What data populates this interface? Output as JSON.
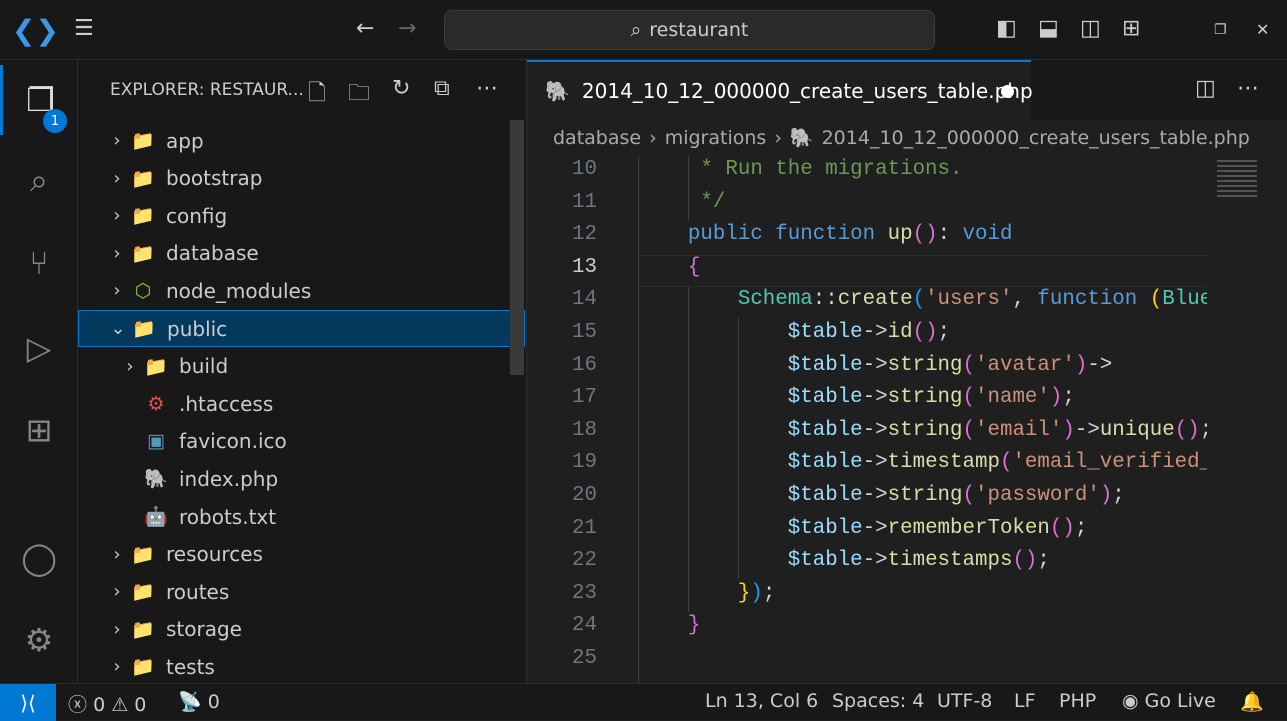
{
  "titlebar": {
    "search_text": "restaurant"
  },
  "activity": {
    "explorer_badge": "1"
  },
  "sidebar": {
    "title": "EXPLORER: RESTAUR...",
    "items": [
      {
        "label": "app",
        "type": "folder",
        "depth": 0,
        "open": false
      },
      {
        "label": "bootstrap",
        "type": "folder",
        "depth": 0,
        "open": false
      },
      {
        "label": "config",
        "type": "folder",
        "depth": 0,
        "open": false
      },
      {
        "label": "database",
        "type": "folder",
        "depth": 0,
        "open": false
      },
      {
        "label": "node_modules",
        "type": "node",
        "depth": 0,
        "open": false
      },
      {
        "label": "public",
        "type": "folder",
        "depth": 0,
        "open": true,
        "selected": true
      },
      {
        "label": "build",
        "type": "folder",
        "depth": 1,
        "open": false
      },
      {
        "label": ".htaccess",
        "type": "gear",
        "depth": 1
      },
      {
        "label": "favicon.ico",
        "type": "image",
        "depth": 1
      },
      {
        "label": "index.php",
        "type": "php",
        "depth": 1
      },
      {
        "label": "robots.txt",
        "type": "robot",
        "depth": 1
      },
      {
        "label": "resources",
        "type": "folder",
        "depth": 0,
        "open": false
      },
      {
        "label": "routes",
        "type": "folder",
        "depth": 0,
        "open": false
      },
      {
        "label": "storage",
        "type": "folder",
        "depth": 0,
        "open": false
      },
      {
        "label": "tests",
        "type": "folder",
        "depth": 0,
        "open": false
      }
    ]
  },
  "editor": {
    "tab_label": "2014_10_12_000000_create_users_table.php",
    "breadcrumbs": [
      "database",
      "migrations",
      "2014_10_12_000000_create_users_table.php"
    ],
    "current_line": 13,
    "lines": [
      {
        "n": 10,
        "tokens": [
          [
            "c",
            "     * Run the migrations."
          ]
        ]
      },
      {
        "n": 11,
        "tokens": [
          [
            "c",
            "     */"
          ]
        ]
      },
      {
        "n": 12,
        "tokens": [
          [
            "k",
            "    public "
          ],
          [
            "k",
            "function "
          ],
          [
            "f",
            "up"
          ],
          [
            "m",
            "()"
          ],
          [
            "p",
            ": "
          ],
          [
            "k",
            "void"
          ]
        ]
      },
      {
        "n": 13,
        "tokens": [
          [
            "m",
            "    {"
          ]
        ]
      },
      {
        "n": 14,
        "tokens": [
          [
            "t",
            "        Schema"
          ],
          [
            "p",
            "::"
          ],
          [
            "f",
            "create"
          ],
          [
            "b",
            "("
          ],
          [
            "s",
            "'users'"
          ],
          [
            "p",
            ", "
          ],
          [
            "k",
            "function "
          ],
          [
            "y",
            "("
          ],
          [
            "t",
            "Blueprint"
          ]
        ]
      },
      {
        "n": 15,
        "tokens": [
          [
            "v",
            "            $table"
          ],
          [
            "p",
            "->"
          ],
          [
            "f",
            "id"
          ],
          [
            "m",
            "()"
          ],
          [
            "p",
            ";"
          ]
        ]
      },
      {
        "n": 16,
        "tokens": [
          [
            "v",
            "            $table"
          ],
          [
            "p",
            "->"
          ],
          [
            "f",
            "string"
          ],
          [
            "m",
            "("
          ],
          [
            "s",
            "'avatar'"
          ],
          [
            "m",
            ")"
          ],
          [
            "p",
            "->"
          ]
        ]
      },
      {
        "n": 17,
        "tokens": [
          [
            "v",
            "            $table"
          ],
          [
            "p",
            "->"
          ],
          [
            "f",
            "string"
          ],
          [
            "m",
            "("
          ],
          [
            "s",
            "'name'"
          ],
          [
            "m",
            ")"
          ],
          [
            "p",
            ";"
          ]
        ]
      },
      {
        "n": 18,
        "tokens": [
          [
            "v",
            "            $table"
          ],
          [
            "p",
            "->"
          ],
          [
            "f",
            "string"
          ],
          [
            "m",
            "("
          ],
          [
            "s",
            "'email'"
          ],
          [
            "m",
            ")"
          ],
          [
            "p",
            "->"
          ],
          [
            "f",
            "unique"
          ],
          [
            "m",
            "()"
          ],
          [
            "p",
            ";"
          ]
        ]
      },
      {
        "n": 19,
        "tokens": [
          [
            "v",
            "            $table"
          ],
          [
            "p",
            "->"
          ],
          [
            "f",
            "timestamp"
          ],
          [
            "m",
            "("
          ],
          [
            "s",
            "'email_verified_at'"
          ]
        ]
      },
      {
        "n": 20,
        "tokens": [
          [
            "v",
            "            $table"
          ],
          [
            "p",
            "->"
          ],
          [
            "f",
            "string"
          ],
          [
            "m",
            "("
          ],
          [
            "s",
            "'password'"
          ],
          [
            "m",
            ")"
          ],
          [
            "p",
            ";"
          ]
        ]
      },
      {
        "n": 21,
        "tokens": [
          [
            "v",
            "            $table"
          ],
          [
            "p",
            "->"
          ],
          [
            "f",
            "rememberToken"
          ],
          [
            "m",
            "()"
          ],
          [
            "p",
            ";"
          ]
        ]
      },
      {
        "n": 22,
        "tokens": [
          [
            "v",
            "            $table"
          ],
          [
            "p",
            "->"
          ],
          [
            "f",
            "timestamps"
          ],
          [
            "m",
            "()"
          ],
          [
            "p",
            ";"
          ]
        ]
      },
      {
        "n": 23,
        "tokens": [
          [
            "y",
            "        }"
          ],
          [
            "b",
            ")"
          ],
          [
            "p",
            ";"
          ]
        ]
      },
      {
        "n": 24,
        "tokens": [
          [
            "m",
            "    }"
          ]
        ]
      },
      {
        "n": 25,
        "tokens": []
      }
    ]
  },
  "status": {
    "errors": "0",
    "warnings": "0",
    "ports": "0",
    "position": "Ln 13, Col 6",
    "spaces": "Spaces: 4",
    "encoding": "UTF-8",
    "eol": "LF",
    "language": "PHP",
    "golive": "Go Live"
  }
}
